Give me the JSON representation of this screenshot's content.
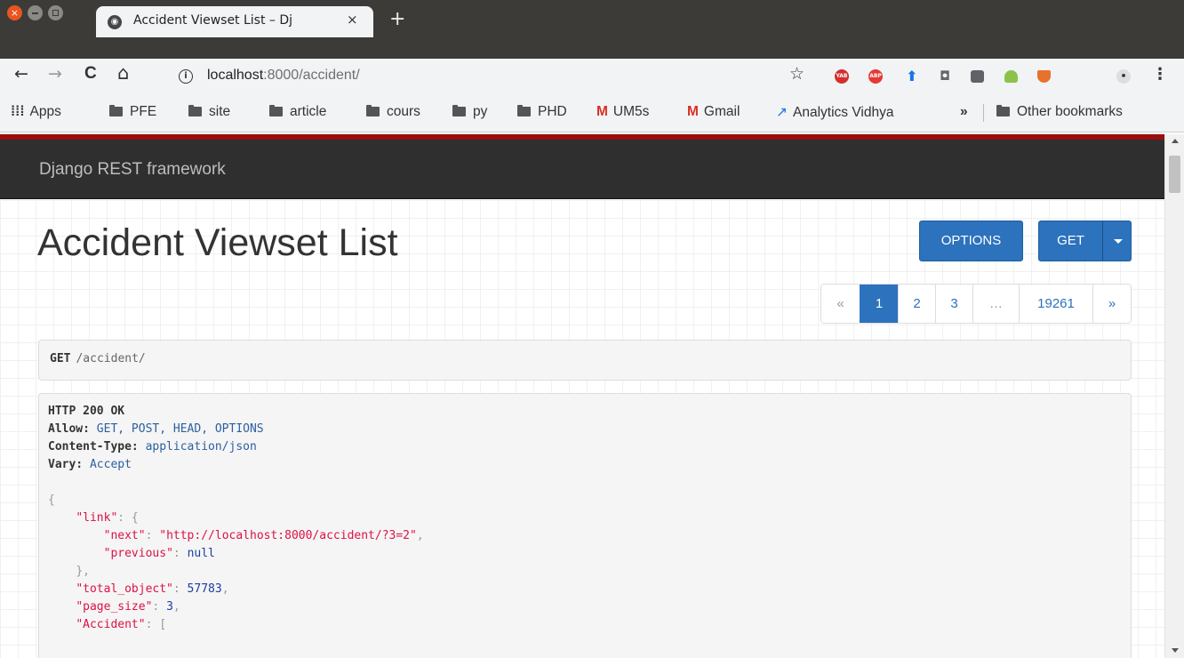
{
  "browser": {
    "tab_title": "Accident Viewset List – Dj",
    "tab_close": "×",
    "new_tab": "+",
    "url_host": "localhost",
    "url_path": ":8000/accident/",
    "nav": {
      "back": "←",
      "forward": "→",
      "reload": "C",
      "home": "⌂"
    },
    "star": "☆",
    "extensions": [
      {
        "name": "YAB",
        "color": "#d32f2f"
      },
      {
        "name": "ABP",
        "color": "#e53935"
      }
    ],
    "menu": "⋮"
  },
  "bookmarks": {
    "apps": "Apps",
    "items": [
      "PFE",
      "site",
      "article",
      "cours",
      "py",
      "PHD"
    ],
    "gmail_items": [
      "UM5s",
      "Gmail"
    ],
    "analytics": "Analytics Vidhya",
    "more": "»",
    "other": "Other bookmarks"
  },
  "navbar": {
    "brand": "Django REST framework"
  },
  "page": {
    "title": "Accident Viewset List",
    "options_button": "OPTIONS",
    "get_button": "GET"
  },
  "pagination": {
    "prev": "«",
    "pages": [
      "1",
      "2",
      "3"
    ],
    "ellipsis": "…",
    "last": "19261",
    "next": "»",
    "active": "1"
  },
  "request": {
    "method": "GET",
    "path": "/accident/"
  },
  "response": {
    "status": "HTTP 200 OK",
    "headers": [
      {
        "key": "Allow:",
        "value": "GET, POST, HEAD, OPTIONS"
      },
      {
        "key": "Content-Type:",
        "value": "application/json"
      },
      {
        "key": "Vary:",
        "value": "Accept"
      }
    ],
    "body": {
      "open_brace": "{",
      "link_key": "\"link\"",
      "next_key": "\"next\"",
      "next_value": "\"http://localhost:8000/accident/?3=2\"",
      "previous_key": "\"previous\"",
      "previous_value": "null",
      "close_link": "},",
      "total_key": "\"total_object\"",
      "total_value": "57783",
      "page_size_key": "\"page_size\"",
      "page_size_value": "3",
      "accident_key": "\"Accident\"",
      "accident_open": "["
    }
  }
}
